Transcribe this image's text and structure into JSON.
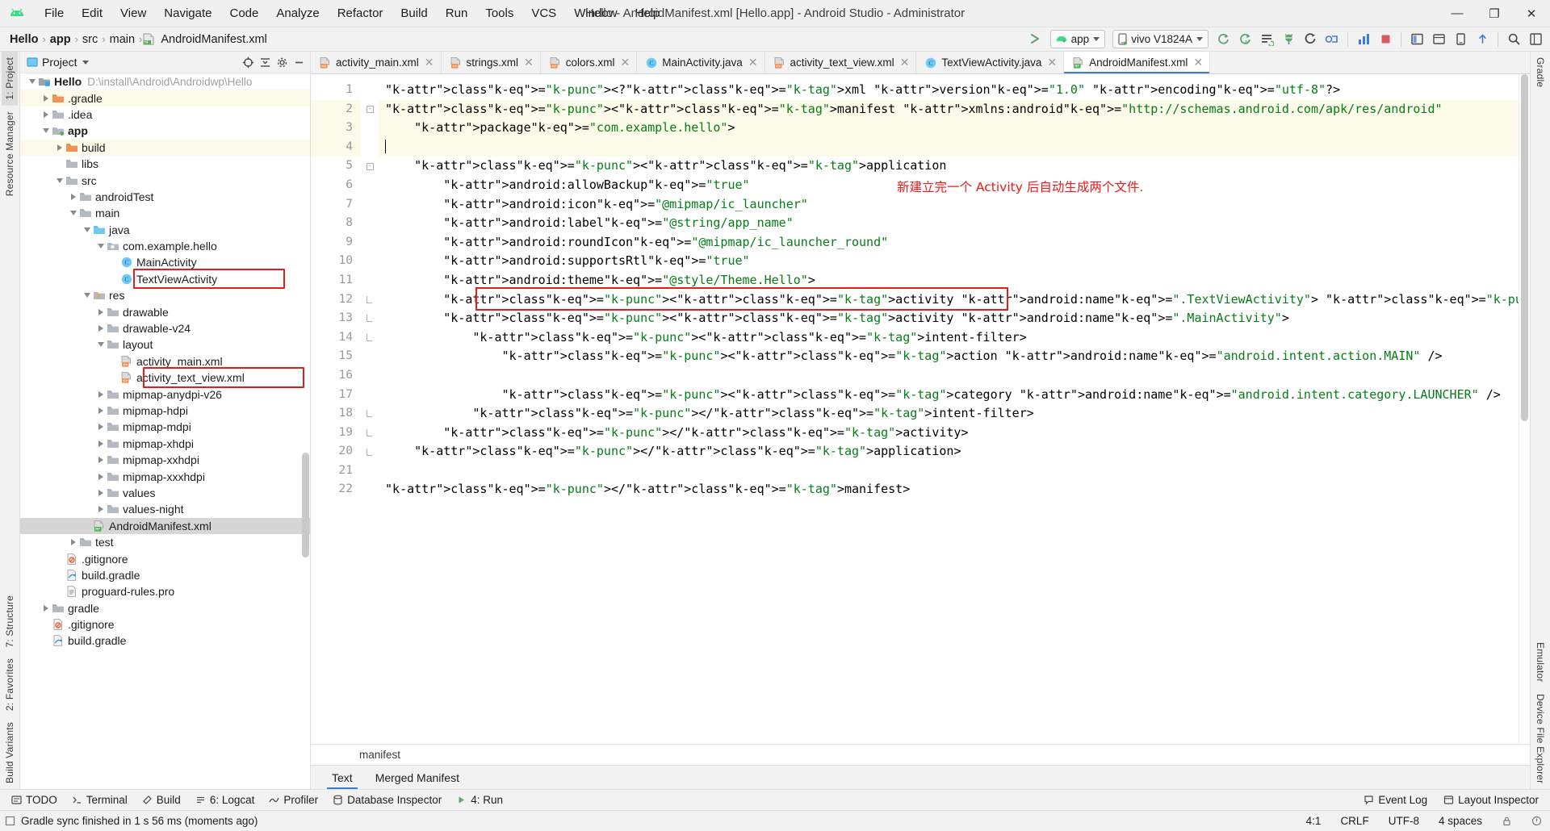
{
  "window": {
    "title": "Hello - AndroidManifest.xml [Hello.app] - Android Studio - Administrator",
    "minimize": "—",
    "maximize": "❐",
    "close": "✕"
  },
  "menu": {
    "items": [
      "File",
      "Edit",
      "View",
      "Navigate",
      "Code",
      "Analyze",
      "Refactor",
      "Build",
      "Run",
      "Tools",
      "VCS",
      "Window",
      "Help"
    ]
  },
  "breadcrumb": {
    "items": [
      "Hello",
      "app",
      "src",
      "main",
      "AndroidManifest.xml"
    ],
    "separator": "›"
  },
  "toolbar": {
    "module_label": "app",
    "device_label": "vivo V1824A",
    "icons": [
      "make-project-icon",
      "app-run-config-icon",
      "device-selector-icon",
      "sync-gradle-icon",
      "avd-manager-icon",
      "sdk-manager-icon",
      "debug-icon",
      "profile-icon",
      "attach-debugger-icon",
      "stop-icon",
      "layout-inspector-icon",
      "device-file-explorer-icon",
      "search-everywhere-icon",
      "project-structure-icon"
    ]
  },
  "left_strip": {
    "tabs": [
      "1: Project",
      "Resource Manager"
    ]
  },
  "right_strip": {
    "tabs": [
      "Gradle",
      "Emulator",
      "Device File Explorer"
    ]
  },
  "left_strip_bottom": {
    "tabs": [
      "7: Structure",
      "2: Favorites",
      "Build Variants"
    ]
  },
  "project_panel": {
    "title": "Project",
    "header_icons": [
      "collapse-target-icon",
      "collapse-all-icon",
      "settings-icon",
      "hide-icon"
    ],
    "tree": [
      {
        "depth": 0,
        "twisty": "down",
        "icon": "module-root-icon",
        "label": "Hello",
        "bold": true,
        "path": "D:\\install\\Android\\Androidwp\\Hello",
        "state": ""
      },
      {
        "depth": 1,
        "twisty": "right",
        "icon": "folder-orange-icon",
        "label": ".gradle",
        "bold": false,
        "path": "",
        "state": "hl"
      },
      {
        "depth": 1,
        "twisty": "right",
        "icon": "folder-icon",
        "label": ".idea",
        "bold": false,
        "path": "",
        "state": ""
      },
      {
        "depth": 1,
        "twisty": "down",
        "icon": "module-icon",
        "label": "app",
        "bold": true,
        "path": "",
        "state": ""
      },
      {
        "depth": 2,
        "twisty": "right",
        "icon": "folder-orange-icon",
        "label": "build",
        "bold": false,
        "path": "",
        "state": "hl"
      },
      {
        "depth": 2,
        "twisty": "none",
        "icon": "folder-icon",
        "label": "libs",
        "bold": false,
        "path": "",
        "state": ""
      },
      {
        "depth": 2,
        "twisty": "down",
        "icon": "folder-icon",
        "label": "src",
        "bold": false,
        "path": "",
        "state": ""
      },
      {
        "depth": 3,
        "twisty": "right",
        "icon": "folder-icon",
        "label": "androidTest",
        "bold": false,
        "path": "",
        "state": ""
      },
      {
        "depth": 3,
        "twisty": "down",
        "icon": "folder-icon",
        "label": "main",
        "bold": false,
        "path": "",
        "state": ""
      },
      {
        "depth": 4,
        "twisty": "down",
        "icon": "folder-source-icon",
        "label": "java",
        "bold": false,
        "path": "",
        "state": ""
      },
      {
        "depth": 5,
        "twisty": "down",
        "icon": "package-icon",
        "label": "com.example.hello",
        "bold": false,
        "path": "",
        "state": ""
      },
      {
        "depth": 6,
        "twisty": "none",
        "icon": "class-icon",
        "label": "MainActivity",
        "bold": false,
        "path": "",
        "state": ""
      },
      {
        "depth": 6,
        "twisty": "none",
        "icon": "class-icon",
        "label": "TextViewActivity",
        "bold": false,
        "path": "",
        "state": ""
      },
      {
        "depth": 4,
        "twisty": "down",
        "icon": "folder-res-icon",
        "label": "res",
        "bold": false,
        "path": "",
        "state": ""
      },
      {
        "depth": 5,
        "twisty": "right",
        "icon": "folder-icon",
        "label": "drawable",
        "bold": false,
        "path": "",
        "state": ""
      },
      {
        "depth": 5,
        "twisty": "right",
        "icon": "folder-icon",
        "label": "drawable-v24",
        "bold": false,
        "path": "",
        "state": ""
      },
      {
        "depth": 5,
        "twisty": "down",
        "icon": "folder-icon",
        "label": "layout",
        "bold": false,
        "path": "",
        "state": ""
      },
      {
        "depth": 6,
        "twisty": "none",
        "icon": "layout-xml-icon",
        "label": "activity_main.xml",
        "bold": false,
        "path": "",
        "state": ""
      },
      {
        "depth": 6,
        "twisty": "none",
        "icon": "layout-xml-icon",
        "label": "activity_text_view.xml",
        "bold": false,
        "path": "",
        "state": ""
      },
      {
        "depth": 5,
        "twisty": "right",
        "icon": "folder-icon",
        "label": "mipmap-anydpi-v26",
        "bold": false,
        "path": "",
        "state": ""
      },
      {
        "depth": 5,
        "twisty": "right",
        "icon": "folder-icon",
        "label": "mipmap-hdpi",
        "bold": false,
        "path": "",
        "state": ""
      },
      {
        "depth": 5,
        "twisty": "right",
        "icon": "folder-icon",
        "label": "mipmap-mdpi",
        "bold": false,
        "path": "",
        "state": ""
      },
      {
        "depth": 5,
        "twisty": "right",
        "icon": "folder-icon",
        "label": "mipmap-xhdpi",
        "bold": false,
        "path": "",
        "state": ""
      },
      {
        "depth": 5,
        "twisty": "right",
        "icon": "folder-icon",
        "label": "mipmap-xxhdpi",
        "bold": false,
        "path": "",
        "state": ""
      },
      {
        "depth": 5,
        "twisty": "right",
        "icon": "folder-icon",
        "label": "mipmap-xxxhdpi",
        "bold": false,
        "path": "",
        "state": ""
      },
      {
        "depth": 5,
        "twisty": "right",
        "icon": "folder-icon",
        "label": "values",
        "bold": false,
        "path": "",
        "state": ""
      },
      {
        "depth": 5,
        "twisty": "right",
        "icon": "folder-icon",
        "label": "values-night",
        "bold": false,
        "path": "",
        "state": ""
      },
      {
        "depth": 4,
        "twisty": "none",
        "icon": "manifest-icon",
        "label": "AndroidManifest.xml",
        "bold": false,
        "path": "",
        "state": "sel"
      },
      {
        "depth": 3,
        "twisty": "right",
        "icon": "folder-icon",
        "label": "test",
        "bold": false,
        "path": "",
        "state": ""
      },
      {
        "depth": 2,
        "twisty": "none",
        "icon": "gitignore-icon",
        "label": ".gitignore",
        "bold": false,
        "path": "",
        "state": ""
      },
      {
        "depth": 2,
        "twisty": "none",
        "icon": "gradle-file-icon",
        "label": "build.gradle",
        "bold": false,
        "path": "",
        "state": ""
      },
      {
        "depth": 2,
        "twisty": "none",
        "icon": "text-file-icon",
        "label": "proguard-rules.pro",
        "bold": false,
        "path": "",
        "state": ""
      },
      {
        "depth": 1,
        "twisty": "right",
        "icon": "folder-icon",
        "label": "gradle",
        "bold": false,
        "path": "",
        "state": ""
      },
      {
        "depth": 1,
        "twisty": "none",
        "icon": "gitignore-icon",
        "label": ".gitignore",
        "bold": false,
        "path": "",
        "state": ""
      },
      {
        "depth": 1,
        "twisty": "none",
        "icon": "gradle-file-icon",
        "label": "build.gradle",
        "bold": false,
        "path": "",
        "state": ""
      }
    ],
    "annotations": [
      {
        "name": "textviewactivity-highlight",
        "target": "TextViewActivity"
      },
      {
        "name": "activity-text-view-xml-highlight",
        "target": "activity_text_view.xml"
      }
    ]
  },
  "editor": {
    "tabs": [
      {
        "label": "activity_main.xml",
        "icon": "layout-xml-icon",
        "active": false
      },
      {
        "label": "strings.xml",
        "icon": "layout-xml-icon",
        "active": false
      },
      {
        "label": "colors.xml",
        "icon": "layout-xml-icon",
        "active": false
      },
      {
        "label": "MainActivity.java",
        "icon": "class-icon",
        "active": false
      },
      {
        "label": "activity_text_view.xml",
        "icon": "layout-xml-icon",
        "active": false
      },
      {
        "label": "TextViewActivity.java",
        "icon": "class-icon",
        "active": false
      },
      {
        "label": "AndroidManifest.xml",
        "icon": "manifest-icon",
        "active": true
      }
    ],
    "close_glyph": "✕",
    "line_numbers": [
      "1",
      "2",
      "3",
      "4",
      "5",
      "6",
      "7",
      "8",
      "9",
      "10",
      "11",
      "12",
      "13",
      "14",
      "15",
      "16",
      "17",
      "18",
      "19",
      "20",
      "21",
      "22"
    ],
    "code_lines": [
      "<?xml version=\"1.0\" encoding=\"utf-8\"?>",
      "<manifest xmlns:android=\"http://schemas.android.com/apk/res/android\"",
      "    package=\"com.example.hello\">",
      "",
      "    <application",
      "        android:allowBackup=\"true\"",
      "        android:icon=\"@mipmap/ic_launcher\"",
      "        android:label=\"@string/app_name\"",
      "        android:roundIcon=\"@mipmap/ic_launcher_round\"",
      "        android:supportsRtl=\"true\"",
      "        android:theme=\"@style/Theme.Hello\">",
      "        <activity android:name=\".TextViewActivity\"> </activity>",
      "        <activity android:name=\".MainActivity\">",
      "            <intent-filter>",
      "                <action android:name=\"android.intent.action.MAIN\" />",
      "",
      "                <category android:name=\"android.intent.category.LAUNCHER\" />",
      "            </intent-filter>",
      "        </activity>",
      "    </application>",
      "",
      "</manifest>"
    ],
    "annotation_note": "新建立完一个 Activity 后自动生成两个文件.",
    "code_annotation": {
      "name": "activity-line-highlight",
      "line": 12
    },
    "breadcrumb_bottom": "manifest",
    "view_tabs": [
      {
        "label": "Text",
        "active": true
      },
      {
        "label": "Merged Manifest",
        "active": false
      }
    ]
  },
  "bottom_toolwindows": {
    "items": [
      {
        "label": "TODO",
        "icon": "todo-icon"
      },
      {
        "label": "Terminal",
        "icon": "terminal-icon"
      },
      {
        "label": "Build",
        "icon": "build-icon"
      },
      {
        "label": "6: Logcat",
        "icon": "logcat-icon"
      },
      {
        "label": "Profiler",
        "icon": "profiler-icon"
      },
      {
        "label": "Database Inspector",
        "icon": "database-icon"
      },
      {
        "label": "4: Run",
        "icon": "run-icon"
      }
    ],
    "right_items": [
      {
        "label": "Event Log",
        "icon": "event-log-icon"
      },
      {
        "label": "Layout Inspector",
        "icon": "layout-inspector-icon"
      }
    ]
  },
  "statusbar": {
    "message": "Gradle sync finished in 1 s 56 ms (moments ago)",
    "caret_position": "4:1",
    "line_separator": "CRLF",
    "encoding": "UTF-8",
    "indent": "4 spaces",
    "icons": [
      "lock-icon",
      "inspection-icon"
    ]
  },
  "colors": {
    "accent_blue": "#3c7ecb",
    "annotation_red": "#e81c1c",
    "xml_tag": "#0033b3",
    "xml_attr": "#871094",
    "xml_string": "#067d17",
    "folder_orange": "#e8a33d",
    "android_green": "#3ddc84"
  }
}
